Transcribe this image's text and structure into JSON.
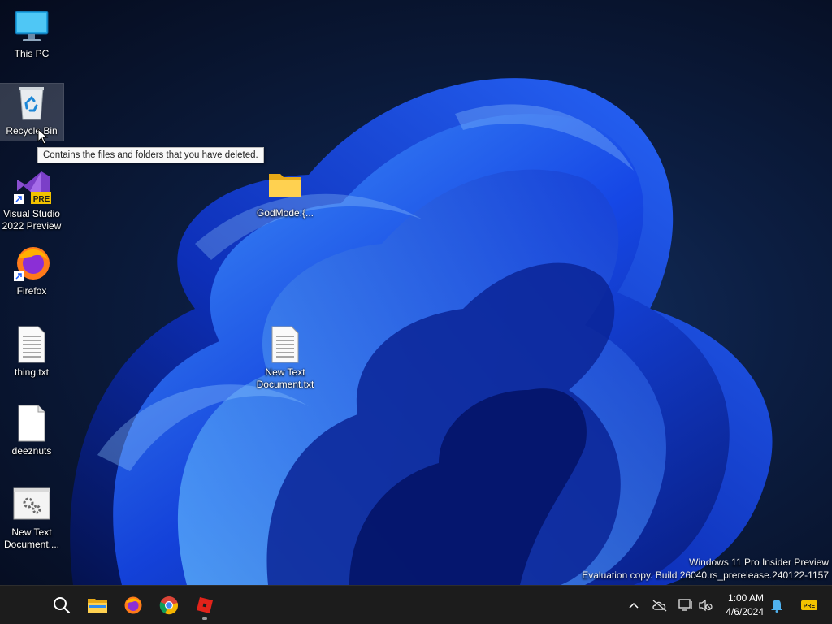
{
  "desktop": {
    "icons": [
      {
        "label": "This PC",
        "icon": "monitor-icon"
      },
      {
        "label": "Recycle Bin",
        "icon": "recycle-bin-icon"
      },
      {
        "label": "Visual Studio\n2022 Preview",
        "icon": "visual-studio-icon",
        "badge": "PRE"
      },
      {
        "label": "Firefox",
        "icon": "firefox-icon"
      },
      {
        "label": "thing.txt",
        "icon": "text-file-icon"
      },
      {
        "label": "deeznuts",
        "icon": "blank-file-icon"
      },
      {
        "label": "New Text\nDocument....",
        "icon": "settings-file-icon"
      },
      {
        "label": "GodMode.{...",
        "icon": "folder-icon"
      },
      {
        "label": "New Text\nDocument.txt",
        "icon": "text-file-icon"
      }
    ],
    "tooltip": "Contains the files and folders that you have deleted.",
    "watermark": {
      "line1": "Windows 11 Pro Insider Preview",
      "line2": "Evaluation copy. Build 26040.rs_prerelease.240122-1157"
    }
  },
  "taskbar": {
    "apps": [
      "search-icon",
      "file-explorer-icon",
      "firefox-icon",
      "chrome-icon",
      "roblox-icon"
    ],
    "tray": [
      "chevron-up-icon",
      "cloud-off-icon",
      "network-icon",
      "speaker-muted-icon",
      "notification-bell-icon"
    ],
    "clock": {
      "time": "1:00 AM",
      "date": "4/6/2024"
    },
    "pre_badge": "PRE"
  },
  "colors": {
    "accent": "#1a5bff",
    "taskbar": "#1c1c1c"
  }
}
